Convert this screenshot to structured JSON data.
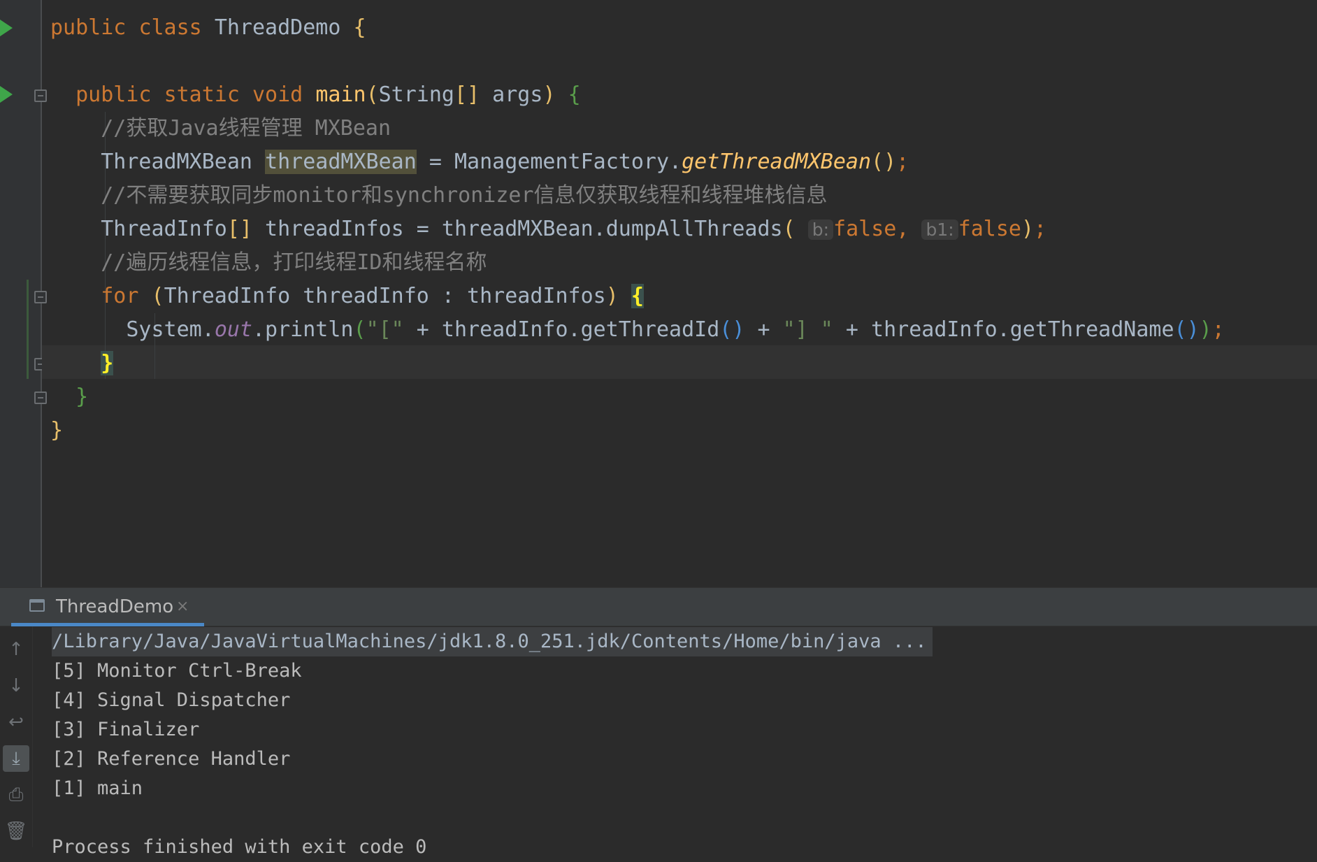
{
  "editor": {
    "lines": [
      {
        "kw1": "public",
        "kw2": "class",
        "name": "ThreadDemo",
        "brace": "{"
      },
      {
        "kw1": "public",
        "kw2": "static",
        "kw3": "void",
        "fn": "main",
        "open": "(",
        "type": "String",
        "arr": "[]",
        "param": " args",
        "close": ")",
        "brace": "{"
      },
      {
        "comment": "//获取Java线程管理 MXBean"
      },
      {
        "type": "ThreadMXBean",
        "var": "threadMXBean",
        "op": " = ",
        "cls": "ManagementFactory",
        "dot": ".",
        "method": "getThreadMXBean",
        "parens": "()",
        "semi": ";"
      },
      {
        "comment": "//不需要获取同步monitor和synchronizer信息仅获取线程和线程堆栈信息"
      },
      {
        "type": "ThreadInfo",
        "arr": "[]",
        "var": " threadInfos = threadMXBean.dumpAllThreads",
        "open": "(",
        "hint1": "b:",
        "val1": "false",
        "comma": ", ",
        "hint2": "b1:",
        "val2": "false",
        "close": ")",
        "semi": ";"
      },
      {
        "comment": "//遍历线程信息，打印线程ID和线程名称"
      },
      {
        "kw": "for",
        "open": "(",
        "body": "ThreadInfo threadInfo : threadInfos",
        "close": ")",
        "brace": "{"
      },
      {
        "sys": "System.",
        "field": "out",
        "println": ".println",
        "open": "(",
        "s1": "\"[\"",
        "mid1": " + threadInfo.getThreadId",
        "p1": "()",
        "mid2": " + ",
        "s2": "\"] \"",
        "mid3": " + threadInfo.getThreadName",
        "p2": "()",
        "close": ")",
        "semi": ";"
      },
      {
        "brace": "}"
      },
      {
        "brace": "}"
      },
      {
        "brace": "}"
      }
    ]
  },
  "run_panel": {
    "tab_label": "ThreadDemo",
    "tab_close": "×",
    "toolbar": {
      "up": "↑",
      "down": "↓",
      "wrap": "↩",
      "scroll_end": "⤓",
      "print": "⎙",
      "clear": "🗑"
    },
    "console": [
      "/Library/Java/JavaVirtualMachines/jdk1.8.0_251.jdk/Contents/Home/bin/java ...",
      "[5] Monitor Ctrl-Break",
      "[4] Signal Dispatcher",
      "[3] Finalizer",
      "[2] Reference Handler",
      "[1] main",
      "",
      "Process finished with exit code 0"
    ]
  },
  "colors": {
    "background": "#2b2b2b",
    "keyword": "#cc7832",
    "method": "#ffc66d",
    "comment": "#808080",
    "string": "#6a8759",
    "accent": "#4a88c7"
  }
}
